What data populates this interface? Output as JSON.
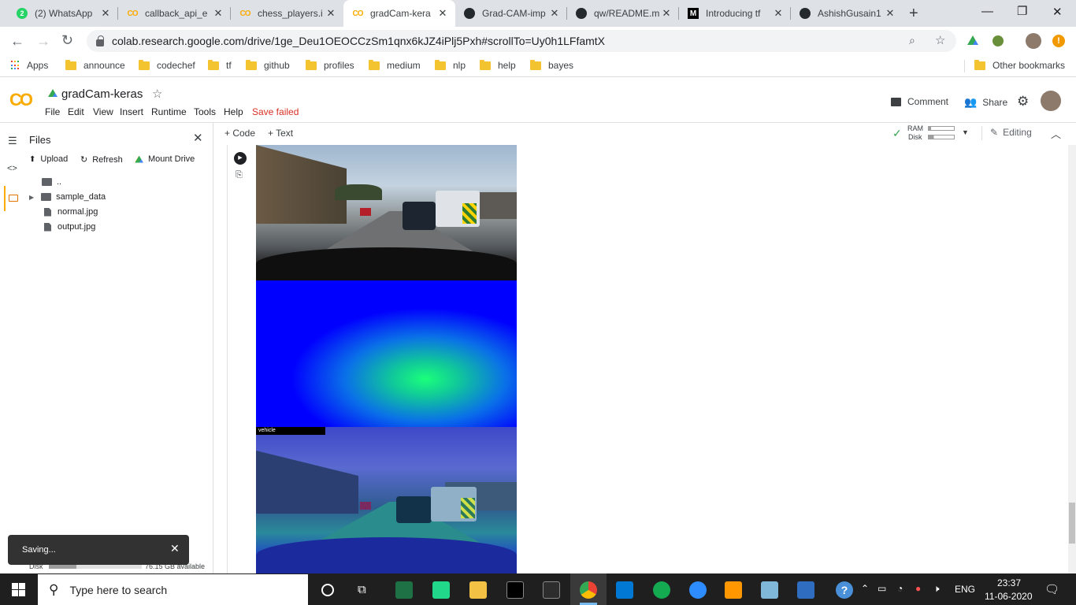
{
  "browser": {
    "tabs": [
      {
        "label": "(2) WhatsApp",
        "icon": "whatsapp-icon"
      },
      {
        "label": "callback_api_e",
        "icon": "colab-icon"
      },
      {
        "label": "chess_players.i",
        "icon": "colab-icon"
      },
      {
        "label": "gradCam-kera",
        "icon": "colab-icon",
        "active": true
      },
      {
        "label": "Grad-CAM-imp",
        "icon": "github-icon"
      },
      {
        "label": "qw/README.m",
        "icon": "github-icon"
      },
      {
        "label": "Introducing tf",
        "icon": "medium-icon"
      },
      {
        "label": "AshishGusain1",
        "icon": "github-icon"
      }
    ],
    "new_tab": "+",
    "url": "colab.research.google.com/drive/1ge_Deu1OEOCCzSm1qnx6kJZ4iPlj5Pxh#scrollTo=Uy0h1LFfamtX",
    "bookmarks": [
      "Apps",
      "announce",
      "codechef",
      "tf",
      "github",
      "profiles",
      "medium",
      "nlp",
      "help",
      "bayes"
    ],
    "other_bookmarks": "Other bookmarks"
  },
  "colab": {
    "logo": "CO",
    "notebook_title": "gradCam-keras",
    "menu": [
      "File",
      "Edit",
      "View",
      "Insert",
      "Runtime",
      "Tools",
      "Help"
    ],
    "save_status": "Save failed",
    "comment_label": "Comment",
    "share_label": "Share",
    "add_code": "+ Code",
    "add_text": "+ Text",
    "ram_label": "RAM",
    "disk_label": "Disk",
    "editing_label": "Editing"
  },
  "files_panel": {
    "title": "Files",
    "upload": "Upload",
    "refresh": "Refresh",
    "mount_drive": "Mount Drive",
    "parent": "..",
    "items": [
      {
        "name": "sample_data",
        "type": "folder"
      },
      {
        "name": "normal.jpg",
        "type": "file"
      },
      {
        "name": "output.jpg",
        "type": "file"
      }
    ],
    "disk_label": "Disk",
    "disk_available": "76.15 GB available"
  },
  "output": {
    "overlay_label": "vehicle"
  },
  "toast": {
    "message": "Saving...",
    "close": "✕"
  },
  "taskbar": {
    "search_placeholder": "Type here to search",
    "language": "ENG",
    "time": "23:37",
    "date": "11-06-2020"
  },
  "colors": {
    "colab_orange": "#f9ab00",
    "save_failed": "#d93025",
    "heatmap_blue": "#0000ff",
    "heatmap_green": "#1bff7a"
  }
}
